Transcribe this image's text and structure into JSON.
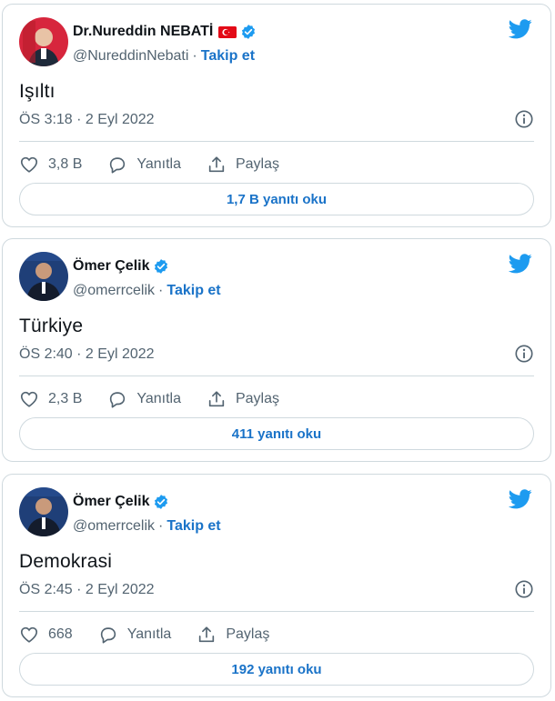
{
  "tweets": [
    {
      "name": "Dr.Nureddin NEBATİ",
      "handle": "@NureddinNebati",
      "separator": "·",
      "follow_label": "Takip et",
      "text": "Işıltı",
      "meta": "ÖS 3:18 · 2 Eyl 2022",
      "likes": "3,8 B",
      "reply_label": "Yanıtla",
      "share_label": "Paylaş",
      "read_replies": "1,7 B yanıtı oku",
      "has_flag": true
    },
    {
      "name": "Ömer Çelik",
      "handle": "@omerrcelik",
      "separator": "·",
      "follow_label": "Takip et",
      "text": "Türkiye",
      "meta": "ÖS 2:40 · 2 Eyl 2022",
      "likes": "2,3 B",
      "reply_label": "Yanıtla",
      "share_label": "Paylaş",
      "read_replies": "411 yanıtı oku",
      "has_flag": false
    },
    {
      "name": "Ömer Çelik",
      "handle": "@omerrcelik",
      "separator": "·",
      "follow_label": "Takip et",
      "text": "Demokrasi",
      "meta": "ÖS 2:45 · 2 Eyl 2022",
      "likes": "668",
      "reply_label": "Yanıtla",
      "share_label": "Paylaş",
      "read_replies": "192 yanıtı oku",
      "has_flag": false
    }
  ],
  "colors": {
    "accent": "#1d9bf0",
    "link": "#1a73c8",
    "muted": "#536471",
    "border": "#cfd9de",
    "flag_red": "#e30a17"
  },
  "icons": {
    "verified": "verified-badge-icon",
    "bird": "twitter-bird-icon",
    "info": "info-icon",
    "like": "heart-icon",
    "reply": "reply-bubble-icon",
    "share": "share-icon"
  }
}
